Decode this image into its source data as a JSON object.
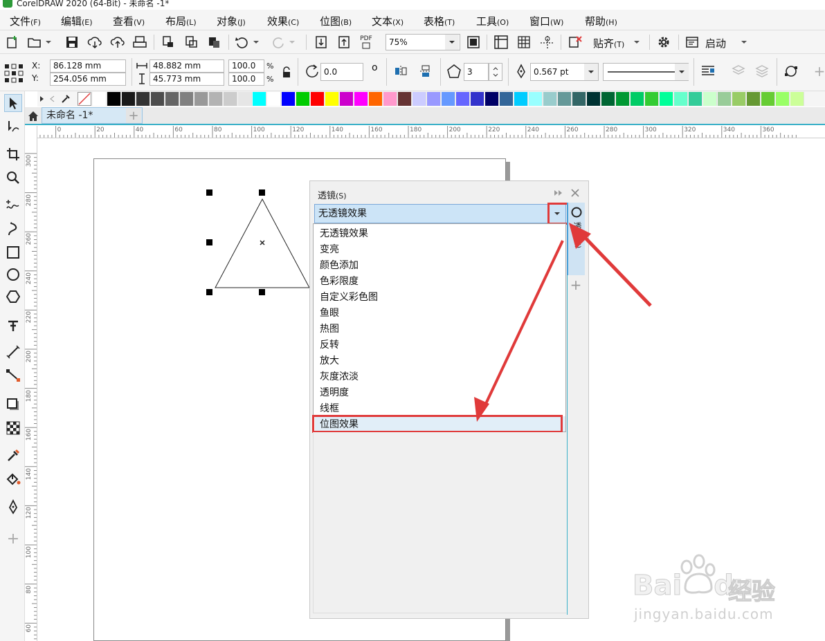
{
  "window": {
    "title": "CorelDRAW 2020 (64-Bit) - 未命名 -1*"
  },
  "menu": [
    {
      "label": "文件",
      "key": "(F)"
    },
    {
      "label": "编辑",
      "key": "(E)"
    },
    {
      "label": "查看",
      "key": "(V)"
    },
    {
      "label": "布局",
      "key": "(L)"
    },
    {
      "label": "对象",
      "key": "(J)"
    },
    {
      "label": "效果",
      "key": "(C)"
    },
    {
      "label": "位图",
      "key": "(B)"
    },
    {
      "label": "文本",
      "key": "(X)"
    },
    {
      "label": "表格",
      "key": "(T)"
    },
    {
      "label": "工具",
      "key": "(O)"
    },
    {
      "label": "窗口",
      "key": "(W)"
    },
    {
      "label": "帮助",
      "key": "(H)"
    }
  ],
  "toolbar": {
    "pdf_label": "PDF",
    "zoom_value": "75%",
    "snap_label": "贴齐",
    "snap_key": "(T)",
    "launch_label": "启动"
  },
  "properties": {
    "x_label": "X:",
    "y_label": "Y:",
    "x_value": "86.128 mm",
    "y_value": "254.056 mm",
    "width_value": "48.882 mm",
    "height_value": "45.773 mm",
    "scale_x": "100.0",
    "scale_y": "100.0",
    "percent": "%",
    "rotation_value": "0.0",
    "rotation_unit": "o",
    "sides_value": "3",
    "outline_width": "0.567 pt"
  },
  "palette": {
    "colors": [
      "#ffffff",
      "#000000",
      "#1a1a1a",
      "#333333",
      "#4d4d4d",
      "#666666",
      "#808080",
      "#999999",
      "#b3b3b3",
      "#cccccc",
      "#e6e6e6",
      "#00ffff",
      "#ffffff",
      "#0000ff",
      "#00cc00",
      "#ff0000",
      "#ffff00",
      "#cc00cc",
      "#ff00ff",
      "#ff6600",
      "#ff99cc",
      "#663333",
      "#ccccff",
      "#9999ff",
      "#6699ff",
      "#6666ff",
      "#3333cc",
      "#000066",
      "#336699",
      "#00ccff",
      "#99ffff",
      "#99cccc",
      "#669999",
      "#336666",
      "#003333",
      "#006633",
      "#009933",
      "#00cc66",
      "#33cc33",
      "#00ff99",
      "#66ffcc",
      "#33cc99",
      "#ccffcc",
      "#99cc99",
      "#99cc66",
      "#669933",
      "#66cc33",
      "#99ff66",
      "#ccff99"
    ]
  },
  "document": {
    "tab_label": "未命名 -1*"
  },
  "rulers": {
    "h_ticks": [
      "20",
      "0",
      "20",
      "40",
      "60",
      "80",
      "100",
      "120",
      "140",
      "160",
      "180",
      "200",
      "220",
      "240",
      "260",
      "280",
      "300",
      "320",
      "340",
      "360"
    ],
    "v_ticks": [
      "300",
      "280",
      "260",
      "240",
      "220",
      "200",
      "180",
      "160",
      "140",
      "120",
      "100",
      "80",
      "60"
    ]
  },
  "docker": {
    "title": "透镜",
    "title_key": "(S)",
    "selected": "无透镜效果",
    "options": [
      "无透镜效果",
      "变亮",
      "颜色添加",
      "色彩限度",
      "自定义彩色图",
      "鱼眼",
      "热图",
      "反转",
      "放大",
      "灰度浓淡",
      "透明度",
      "线框",
      "位图效果"
    ],
    "side_tab_label": "透镜",
    "side_tab_key": "(S)"
  },
  "watermark": {
    "brand_bai": "Bai",
    "brand_du": "du",
    "brand_cn": "经验",
    "url": "jingyan.baidu.com"
  },
  "colors": {
    "accent": "#3ab0c8",
    "highlight": "#e03a3a",
    "selection": "#cce4f7"
  }
}
